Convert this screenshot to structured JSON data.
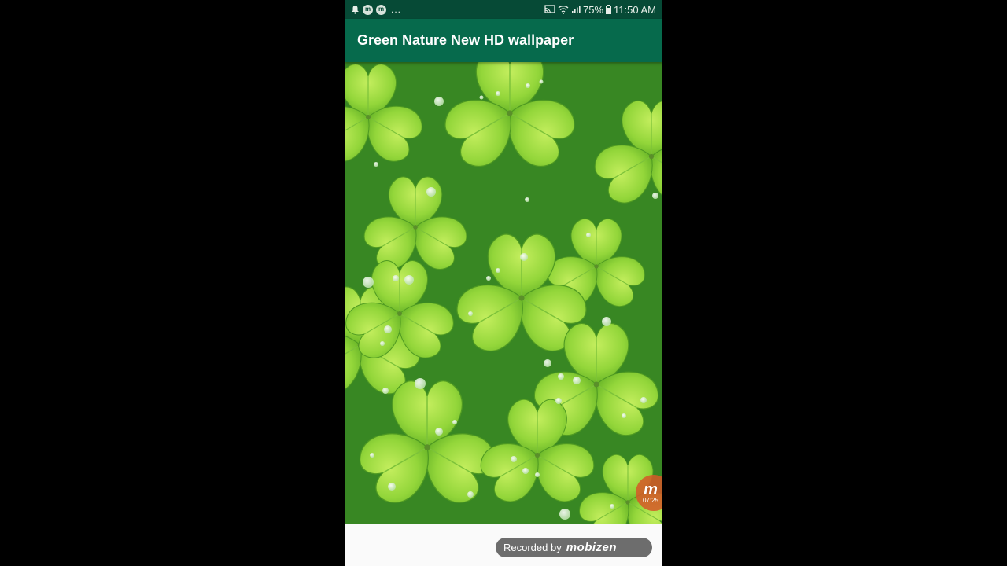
{
  "status_bar": {
    "left_icons": [
      "notification-bell-icon",
      "m-app-icon",
      "m-app-icon"
    ],
    "ellipsis": "...",
    "right_icons": [
      "cast-icon",
      "wifi-icon",
      "signal-icon"
    ],
    "battery": "75%",
    "time": "11:50 AM"
  },
  "app_bar": {
    "title": "Green Nature New HD wallpaper"
  },
  "wallpaper": {
    "subject": "clover-leaves-with-dew-drops"
  },
  "overlay": {
    "brand_letter": "m",
    "timer": "07:25"
  },
  "recorder": {
    "label": "Recorded by",
    "brand": "mobizen"
  },
  "colors": {
    "status_bar": "#064a36",
    "app_bar": "#066a4c",
    "leaf": "#8fd33a",
    "background": "#000000"
  }
}
